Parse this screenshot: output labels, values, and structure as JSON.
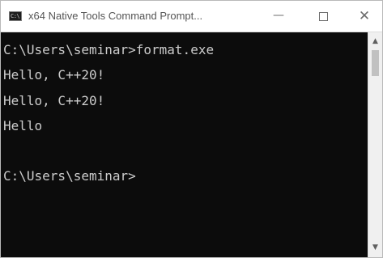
{
  "window": {
    "title": "x64 Native Tools Command Prompt...",
    "icon_text": "C:\\",
    "icon": "console-icon",
    "buttons": {
      "minimize": "—",
      "close": "✕"
    }
  },
  "console": {
    "lines": [
      "C:\\Users\\seminar>format.exe",
      "Hello, C++20!",
      "Hello, C++20!",
      "Hello",
      "",
      "C:\\Users\\seminar>"
    ],
    "text_color": "#cccccc",
    "background": "#0c0c0c"
  },
  "scrollbar": {
    "up_arrow": "▲",
    "down_arrow": "▼"
  }
}
